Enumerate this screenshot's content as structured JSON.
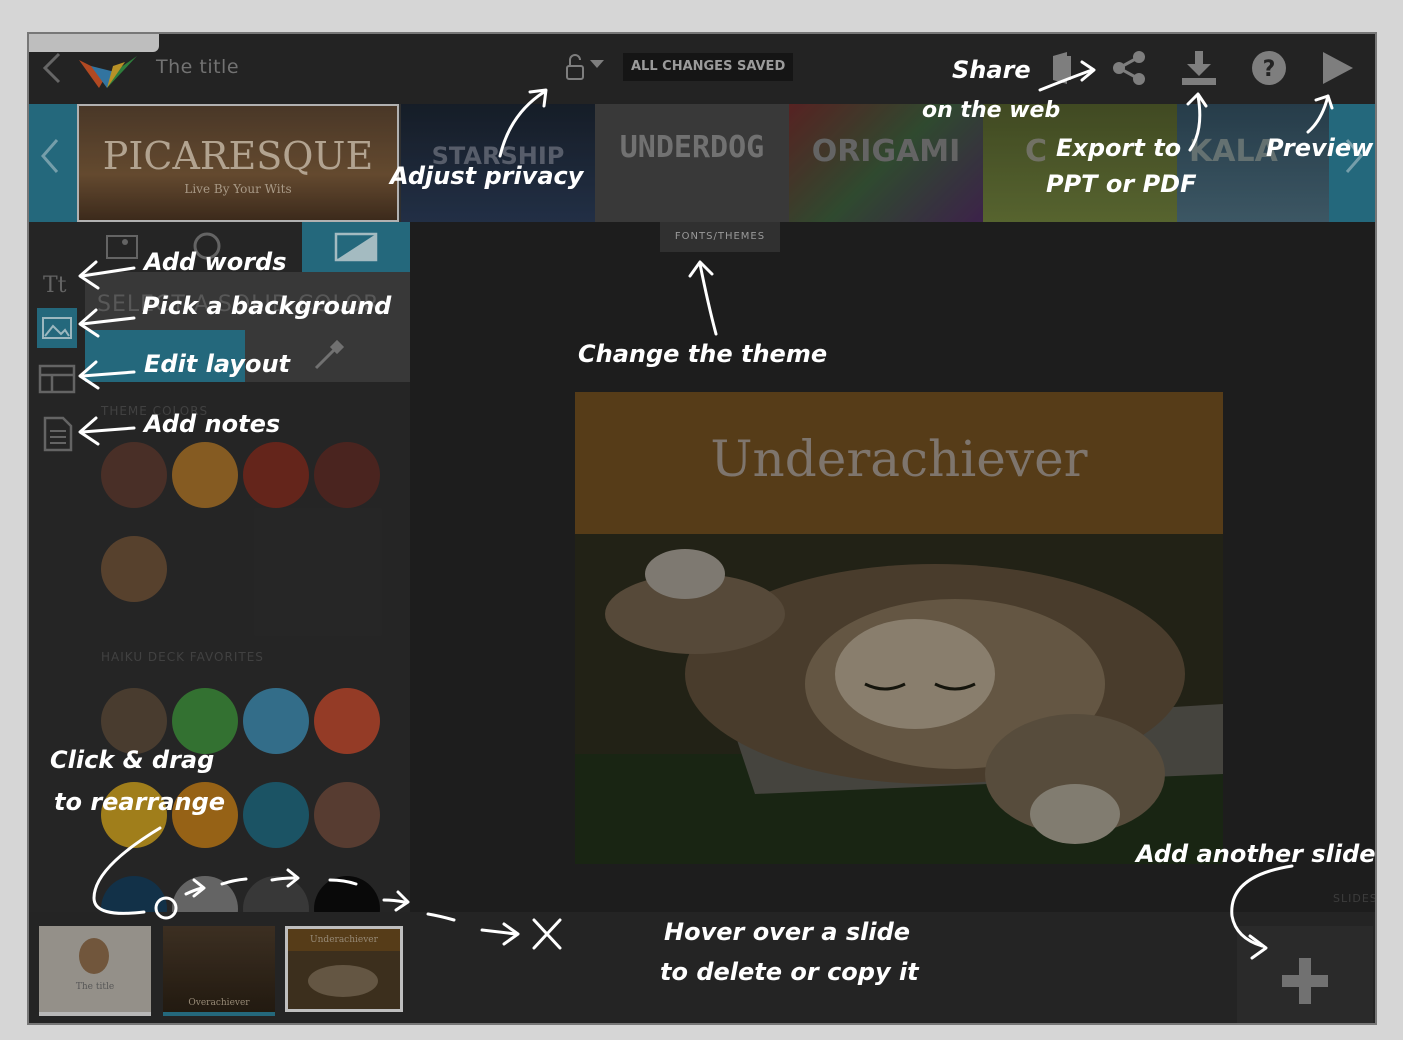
{
  "app": {
    "title": "The title",
    "save_status": "ALL CHANGES SAVED"
  },
  "themes": {
    "items": [
      {
        "name": "PICARESQUE",
        "subtitle": "Live By Your Wits"
      },
      {
        "name": "STARSHIP",
        "subtitle": ""
      },
      {
        "name": "UNDERDOG",
        "subtitle": ""
      },
      {
        "name": "ORIGAMI",
        "subtitle": ""
      },
      {
        "name": "C",
        "subtitle": ""
      },
      {
        "name": "KALA",
        "subtitle": ""
      }
    ],
    "tab_label": "FONTS/THEMES"
  },
  "panel": {
    "select_label": "SELECT A SOLID COLOR",
    "theme_colors_label": "THEME COLORS",
    "favorites_label": "HAIKU DECK FAVORITES",
    "theme_colors": [
      "#5a3a30",
      "#a3702a",
      "#7a2e22",
      "#5b2c26",
      "#6b5038"
    ],
    "favorite_colors": [
      "#3f8a3c",
      "#3f86a8",
      "#b5492f",
      "#c49a22",
      "#b8781c",
      "#22667a",
      "#6b4a3c",
      "#173c58",
      "#7a7a7a",
      "#454545",
      "#0c0c0c"
    ]
  },
  "slide": {
    "title": "Underachiever"
  },
  "bottom": {
    "slides_label": "SLIDES",
    "thumbnails": [
      {
        "label": "The title"
      },
      {
        "label": "Overachiever"
      },
      {
        "label": "Underachiever"
      }
    ]
  },
  "annotations": {
    "share": "Share",
    "share_web": "on the web",
    "export1": "Export to",
    "export2": "PPT or PDF",
    "preview": "Preview",
    "privacy": "Adjust privacy",
    "theme": "Change the theme",
    "words": "Add words",
    "background": "Pick a background",
    "layout": "Edit layout",
    "notes": "Add notes",
    "drag1": "Click & drag",
    "drag2": "to rearrange",
    "hover1": "Hover over a slide",
    "hover2": "to delete or copy it",
    "another": "Add another slide"
  },
  "icons": {
    "back": "chevron-left-icon",
    "lock": "lock-icon",
    "share_web": "publish-icon",
    "share": "share-icon",
    "export": "download-icon",
    "help": "help-icon",
    "preview": "play-icon",
    "text": "text-icon",
    "image": "image-icon",
    "layout": "layout-icon",
    "notes": "notes-icon",
    "add": "plus-icon"
  },
  "colors": {
    "accent": "#2c7f98",
    "slide_header": "#6a4a1e"
  }
}
